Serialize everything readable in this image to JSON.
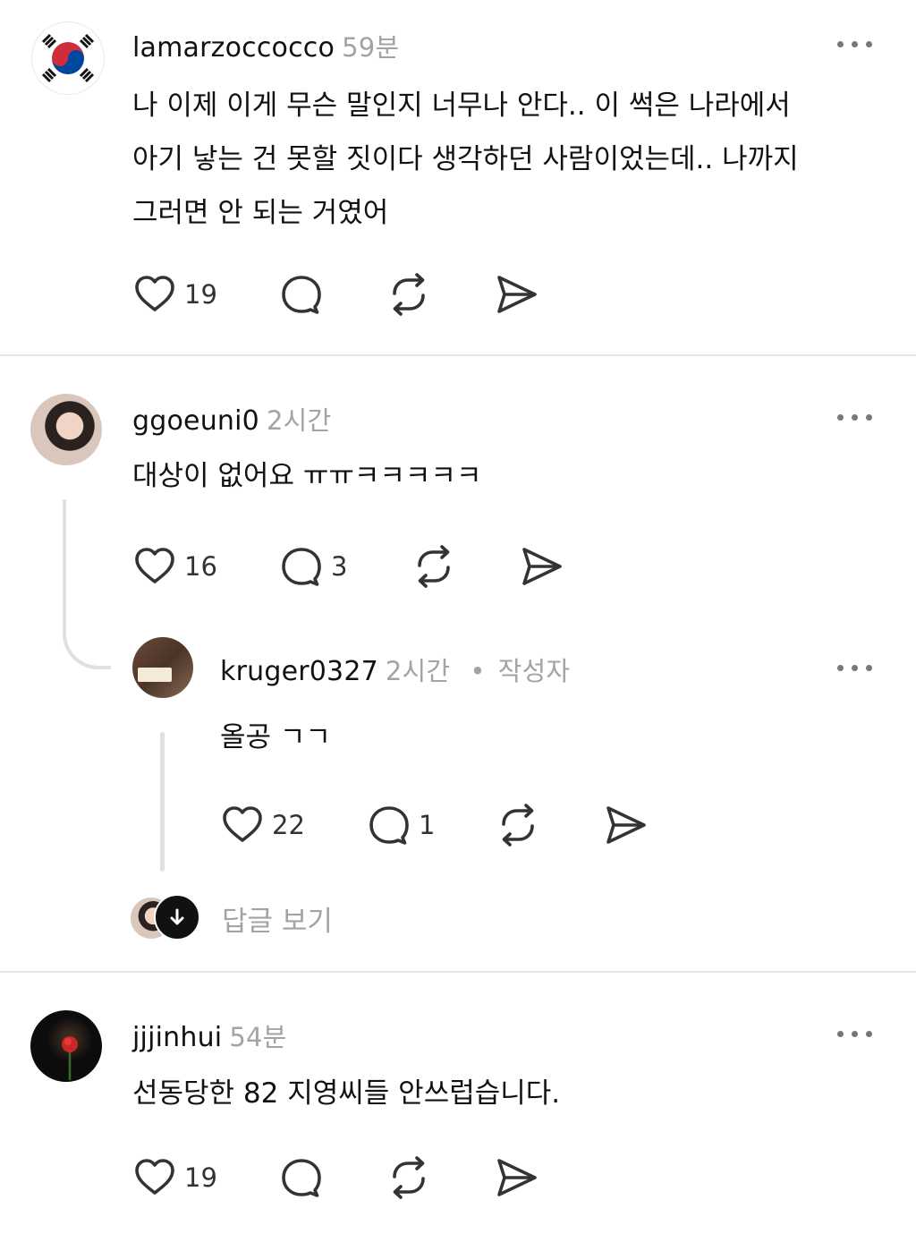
{
  "comments": [
    {
      "username": "lamarzoccocco",
      "time": "59분",
      "lines": [
        "나 이제 이게 무슨 말인지 너무나 안다.. 이 썩은 나라에서",
        "아기 낳는 건 못할 짓이다 생각하던 사람이었는데.. 나까지",
        "그러면 안 되는 거였어"
      ],
      "likes": "19",
      "replies": ""
    },
    {
      "username": "ggoeuni0",
      "time": "2시간",
      "lines": [
        "대상이 없어요 ㅠㅠㅋㅋㅋㅋㅋ"
      ],
      "likes": "16",
      "replies": "3",
      "reply": {
        "username": "kruger0327",
        "time": "2시간",
        "separator": "•",
        "author_badge": "작성자",
        "lines": [
          "올공 ㄱㄱ"
        ],
        "likes": "22",
        "replies": "1"
      },
      "view_replies_label": "답글 보기"
    },
    {
      "username": "jjjinhui",
      "time": "54분",
      "lines": [
        "선동당한 82 지영씨들 안쓰럽습니다."
      ],
      "likes": "19",
      "replies": ""
    }
  ],
  "colors": {
    "text": "#111111",
    "muted": "#a3a3a3",
    "divider": "#e6e6e6",
    "icon": "#333333"
  },
  "icons": [
    "heart-icon",
    "comment-icon",
    "repost-icon",
    "share-icon",
    "more-icon",
    "arrow-down-icon"
  ]
}
